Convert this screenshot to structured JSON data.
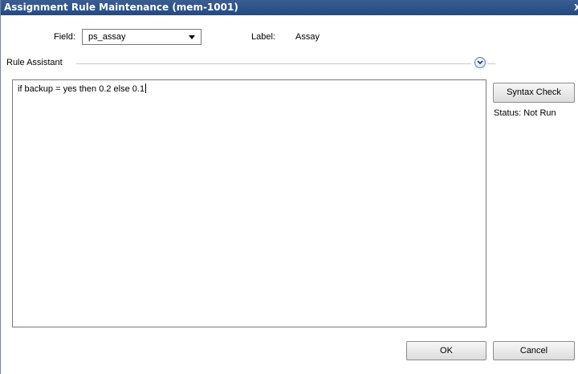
{
  "window": {
    "title": "Assignment Rule Maintenance (mem-1001)",
    "close_glyph": "X"
  },
  "form": {
    "field_label": "Field:",
    "field_value": "ps_assay",
    "label_caption": "Label:",
    "label_value": "Assay"
  },
  "rule_assistant": {
    "label": "Rule Assistant",
    "expanded": false
  },
  "editor": {
    "text": "if backup = yes then 0.2 else 0.1"
  },
  "side": {
    "syntax_check_label": "Syntax Check",
    "status_text": "Status: Not Run"
  },
  "footer": {
    "ok_label": "OK",
    "cancel_label": "Cancel"
  },
  "colors": {
    "titlebar": "#2f5289",
    "accent": "#5d7fb8"
  }
}
